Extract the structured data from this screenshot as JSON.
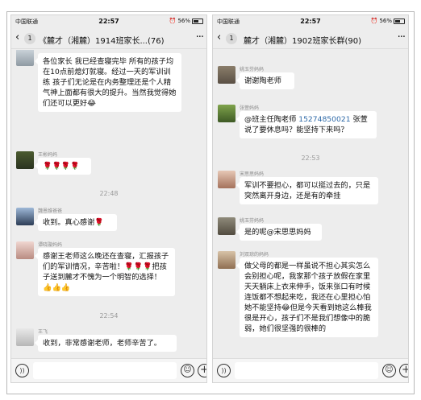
{
  "status": {
    "carrier": "中国联通",
    "time": "22:57",
    "battery": "56%"
  },
  "left": {
    "unread": "1",
    "title": "《麓才（湘麓）1914班家长...(76)",
    "messages": [
      {
        "sender": "",
        "text": "各位家长 我已经查寝完毕 所有的孩子均在10点前熄灯就寝。经过一天的军训训练 孩子们无论是在内务整理还是个人精气神上面都有很大的提升。当然我觉得她们还可以更好😂"
      },
      {
        "sender": "王彬妈妈",
        "text": "🌹🌹🌹🌹"
      },
      {
        "time": "22:48"
      },
      {
        "sender": "魏恩维爸爸",
        "text": "收到。真心感谢🌹"
      },
      {
        "sender": "谭晓璇妈妈",
        "text": "感谢王老师这么晚还在查寝，汇报孩子们的军训情况，辛苦啦！🌹🌹🌹把孩子送到麓才不愧为一个明智的选择！👍👍👍"
      },
      {
        "time": "22:54"
      },
      {
        "sender": "王飞",
        "text": "收到，非常感谢老师，老师辛苦了。"
      }
    ]
  },
  "right": {
    "unread": "1",
    "title": "麓才（湘麓）1902班家长群(90)",
    "messages": [
      {
        "sender": "姚玉芬妈妈",
        "text": "谢谢陶老师"
      },
      {
        "sender": "张萱妈妈",
        "text_pre": "@班主任陶老师 ",
        "phone": "15274850021",
        "text_post": " 张萱说了要休息吗？能坚持下来吗？"
      },
      {
        "time": "22:53"
      },
      {
        "sender": "宋思思妈妈",
        "text": "军训不要担心，都可以挺过去的，只是突然离开身边，还是有的牵挂"
      },
      {
        "sender": "姚玉芬妈妈",
        "text": "是的呢@宋思思妈妈"
      },
      {
        "sender": "刘双琼的妈妈",
        "text": "做父母的都是一样虽说不担心其实怎么会别担心呢，我家那个孩子放假在家里天天躺床上衣来伸手，饭来张口有时候连饭都不想起来吃，我还在心里担心怕她不能坚持😂但是今天看到她这么棒我很是开心，孩子们不是我们想像中的脆弱，她们很坚强的很棒的"
      }
    ]
  }
}
